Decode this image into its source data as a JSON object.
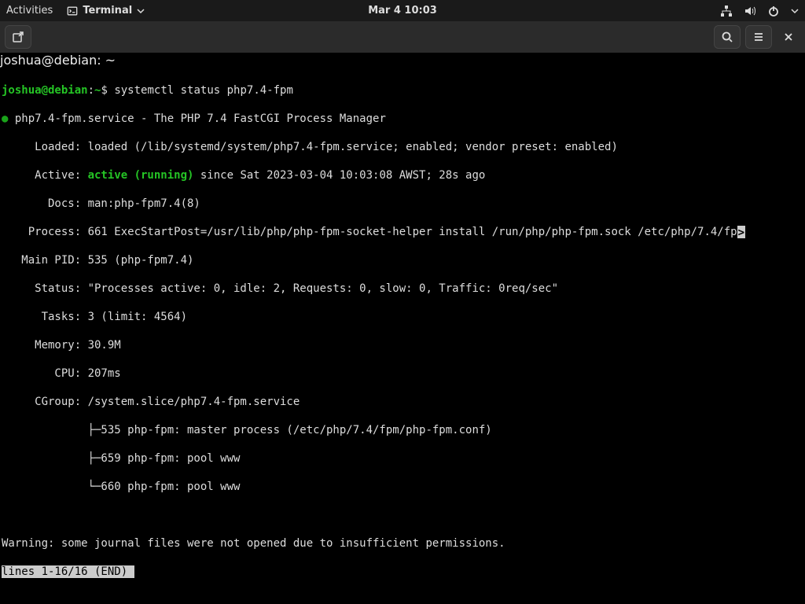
{
  "gnome": {
    "activities": "Activities",
    "app_label": "Terminal",
    "clock": "Mar 4  10:03"
  },
  "window": {
    "title": "joshua@debian: ~"
  },
  "prompt": {
    "userhost": "joshua@debian",
    "path": "~",
    "sep1": ":",
    "sep2": "$ ",
    "command": "systemctl status php7.4-fpm"
  },
  "status": {
    "bullet": "●",
    "unit_line": " php7.4-fpm.service - The PHP 7.4 FastCGI Process Manager",
    "loaded": "     Loaded: loaded (/lib/systemd/system/php7.4-fpm.service; enabled; vendor preset: enabled)",
    "active_label": "     Active: ",
    "active_value": "active (running)",
    "active_tail": " since Sat 2023-03-04 10:03:08 AWST; 28s ago",
    "docs": "       Docs: man:php-fpm7.4(8)",
    "process_head": "    Process: 661 ExecStartPost=/usr/lib/php/php-fpm-socket-helper install /run/php/php-fpm.sock /etc/php/7.4/fp",
    "process_overflow": ">",
    "mainpid": "   Main PID: 535 (php-fpm7.4)",
    "statusl": "     Status: \"Processes active: 0, idle: 2, Requests: 0, slow: 0, Traffic: 0req/sec\"",
    "tasks": "      Tasks: 3 (limit: 4564)",
    "memory": "     Memory: 30.9M",
    "cpu": "        CPU: 207ms",
    "cgroup": "     CGroup: /system.slice/php7.4-fpm.service",
    "tree1": "             ├─535 php-fpm: master process (/etc/php/7.4/fpm/php-fpm.conf)",
    "tree2": "             ├─659 php-fpm: pool www",
    "tree3": "             └─660 php-fpm: pool www",
    "blank": "",
    "warn": "Warning: some journal files were not opened due to insufficient permissions.",
    "pager": "lines 1-16/16 (END)"
  }
}
